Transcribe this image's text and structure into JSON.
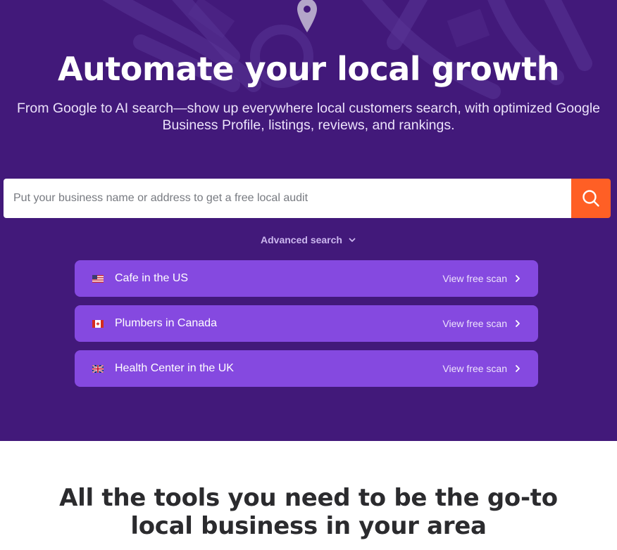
{
  "hero": {
    "title": "Automate your local growth",
    "subtitle": "From Google to AI search—show up everywhere local customers search, with optimized Google Business Profile, listings, reviews, and rankings."
  },
  "search": {
    "placeholder": "Put your business name or address to get a free local audit",
    "button_icon": "search-icon"
  },
  "advanced_search": {
    "label": "Advanced search",
    "icon": "chevron-down-icon"
  },
  "scans": [
    {
      "flag": "us-flag-icon",
      "label": "Cafe in the US",
      "cta": "View free scan"
    },
    {
      "flag": "canada-flag-icon",
      "label": "Plumbers in Canada",
      "cta": "View free scan"
    },
    {
      "flag": "uk-flag-icon",
      "label": "Health Center in the UK",
      "cta": "View free scan"
    }
  ],
  "section": {
    "title": "All the tools you need to be the go-to local business in your area"
  },
  "colors": {
    "hero_bg": "#42197a",
    "scan_bg": "#8549e0",
    "search_button": "#ff5f25",
    "section_text": "#2b2b2e"
  }
}
